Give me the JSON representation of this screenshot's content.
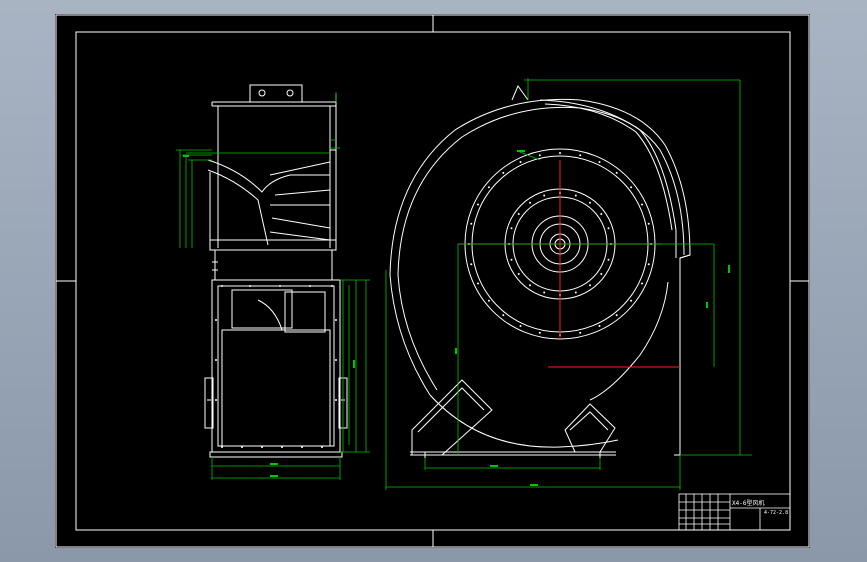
{
  "colors": {
    "background": "#8f9cae",
    "sheet": "#000000",
    "lines": "#ffffff",
    "dimensions": "#00c400",
    "centerline": "#ff2020"
  },
  "views": {
    "side_view": "side view of centrifugal fan with inlet box and base frame",
    "front_view": "front view of centrifugal fan scroll casing with impeller and feet"
  },
  "title_block": {
    "drawing_title": "X4-6型风机",
    "drawing_number": "4-72-2.8"
  }
}
